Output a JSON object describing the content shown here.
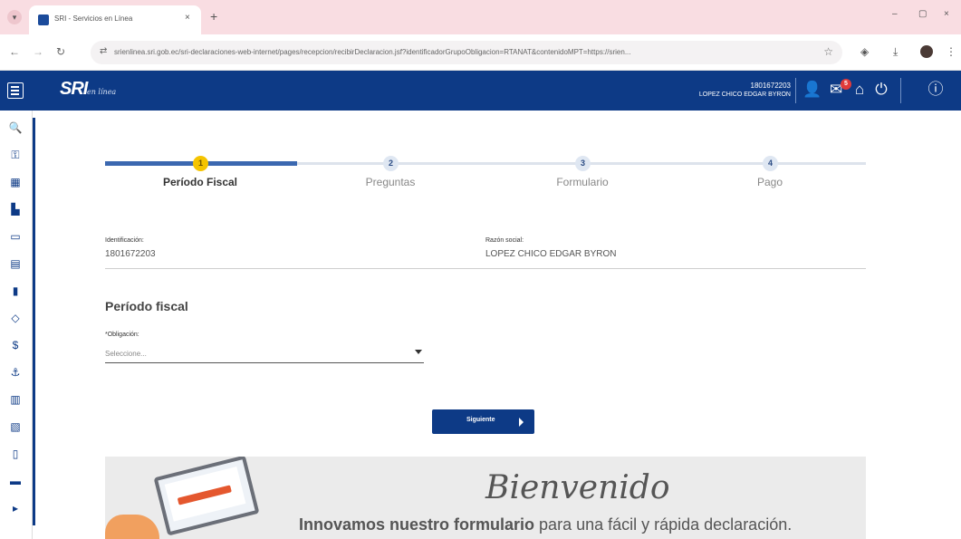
{
  "browser": {
    "tab_title": "SRI - Servicios en Línea",
    "url": "srienlinea.sri.gob.ec/sri-declaraciones-web-internet/pages/recepcion/recibirDeclaracion.jsf?identificadorGrupoObligacion=RTANAT&contenidoMPT=https://srien...",
    "glyphs": {
      "tab_menu": "▾",
      "tab_close": "×",
      "new_tab": "+",
      "minimize": "–",
      "maximize": "▢",
      "close": "×",
      "back": "←",
      "forward": "→",
      "reload": "↻",
      "site_info": "⇄",
      "bookmark": "☆",
      "extensions": "◈",
      "download": "⤓",
      "more": "⋮"
    }
  },
  "header": {
    "logo_main": "SRI",
    "logo_sub": "en línea",
    "user_id": "1801672203",
    "user_name": "LOPEZ CHICO EDGAR BYRON",
    "notification_count": "5",
    "glyphs": {
      "user": "👤",
      "mail": "✉",
      "home": "⌂",
      "power": "⏻",
      "info": "ⓘ"
    }
  },
  "rail_icons": [
    {
      "name": "search-icon",
      "glyph": "🔍"
    },
    {
      "name": "key-icon",
      "glyph": "⚿"
    },
    {
      "name": "books-icon",
      "glyph": "▦"
    },
    {
      "name": "building-icon",
      "glyph": "▙"
    },
    {
      "name": "folder-icon",
      "glyph": "▭"
    },
    {
      "name": "calculator-icon",
      "glyph": "▤"
    },
    {
      "name": "document-icon",
      "glyph": "▮"
    },
    {
      "name": "tag-icon",
      "glyph": "◇"
    },
    {
      "name": "dollar-icon",
      "glyph": "$"
    },
    {
      "name": "anchor-icon",
      "glyph": "⚓"
    },
    {
      "name": "truck-icon",
      "glyph": "▥"
    },
    {
      "name": "receipt-icon",
      "glyph": "▧"
    },
    {
      "name": "file-icon",
      "glyph": "▯"
    },
    {
      "name": "car-icon",
      "glyph": "▬"
    },
    {
      "name": "more-icon",
      "glyph": "▸"
    }
  ],
  "stepper": {
    "steps": [
      {
        "number": "1",
        "label": "Período Fiscal",
        "active": true
      },
      {
        "number": "2",
        "label": "Preguntas",
        "active": false
      },
      {
        "number": "3",
        "label": "Formulario",
        "active": false
      },
      {
        "number": "4",
        "label": "Pago",
        "active": false
      }
    ]
  },
  "taxpayer": {
    "id_label": "Identificación:",
    "id_value": "1801672203",
    "name_label": "Razón social:",
    "name_value": "LOPEZ CHICO EDGAR BYRON"
  },
  "form": {
    "section_title": "Período fiscal",
    "obligation_label": "*Obligación:",
    "obligation_value": "Seleccione..."
  },
  "next_button": "Siguiente",
  "banner": {
    "title": "Bienvenido",
    "tagline_bold": "Innovamos nuestro formulario",
    "tagline_rest": " para una fácil y rápida declaración."
  },
  "colors": {
    "brand": "#0d3a86",
    "accent": "#f5c400",
    "progress": "#3b68b0",
    "badge": "#e13a3a"
  }
}
